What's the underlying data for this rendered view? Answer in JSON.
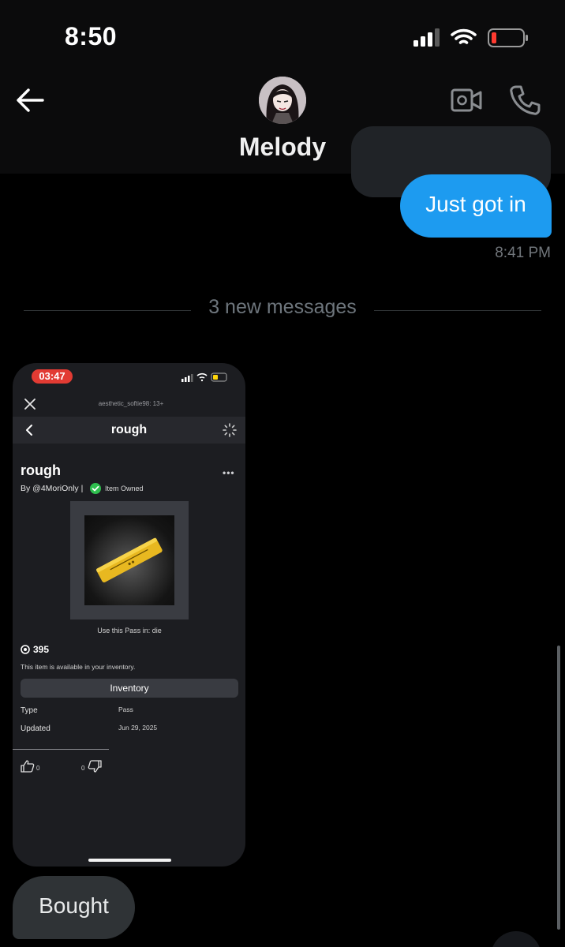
{
  "status_bar": {
    "time": "8:50",
    "icons": [
      "signal-icon",
      "wifi-icon",
      "battery-low-icon"
    ]
  },
  "header": {
    "back_icon": "back-arrow-icon",
    "contact_name": "Melody",
    "video_icon": "video-call-icon",
    "phone_icon": "phone-call-icon"
  },
  "messages": {
    "sent": {
      "text": "Just got in",
      "time": "8:41 PM"
    },
    "divider": "3 new messages",
    "received": {
      "text": "Bought"
    }
  },
  "shared_screenshot": {
    "status_time": "03:47",
    "topbar_title": "aesthetic_softie98: 13+",
    "nav_title": "rough",
    "item": {
      "title": "rough",
      "by": "By @4MoriOnly",
      "owned": "Item Owned",
      "more": "•••",
      "use_pass": "Use this Pass in: die",
      "price": "395",
      "available": "This item is available in your inventory.",
      "inventory_button": "Inventory",
      "type_label": "Type",
      "type_value": "Pass",
      "updated_label": "Updated",
      "updated_value": "Jun 29, 2025",
      "likes": "0",
      "dislikes": "0"
    }
  },
  "colors": {
    "background": "#000000",
    "sent_bubble": "#1d9bf0",
    "received_bubble": "#2f3336",
    "pill_red": "#e23b33",
    "owned_green": "#2fbf4f",
    "pass_gold": "#e8b820"
  }
}
